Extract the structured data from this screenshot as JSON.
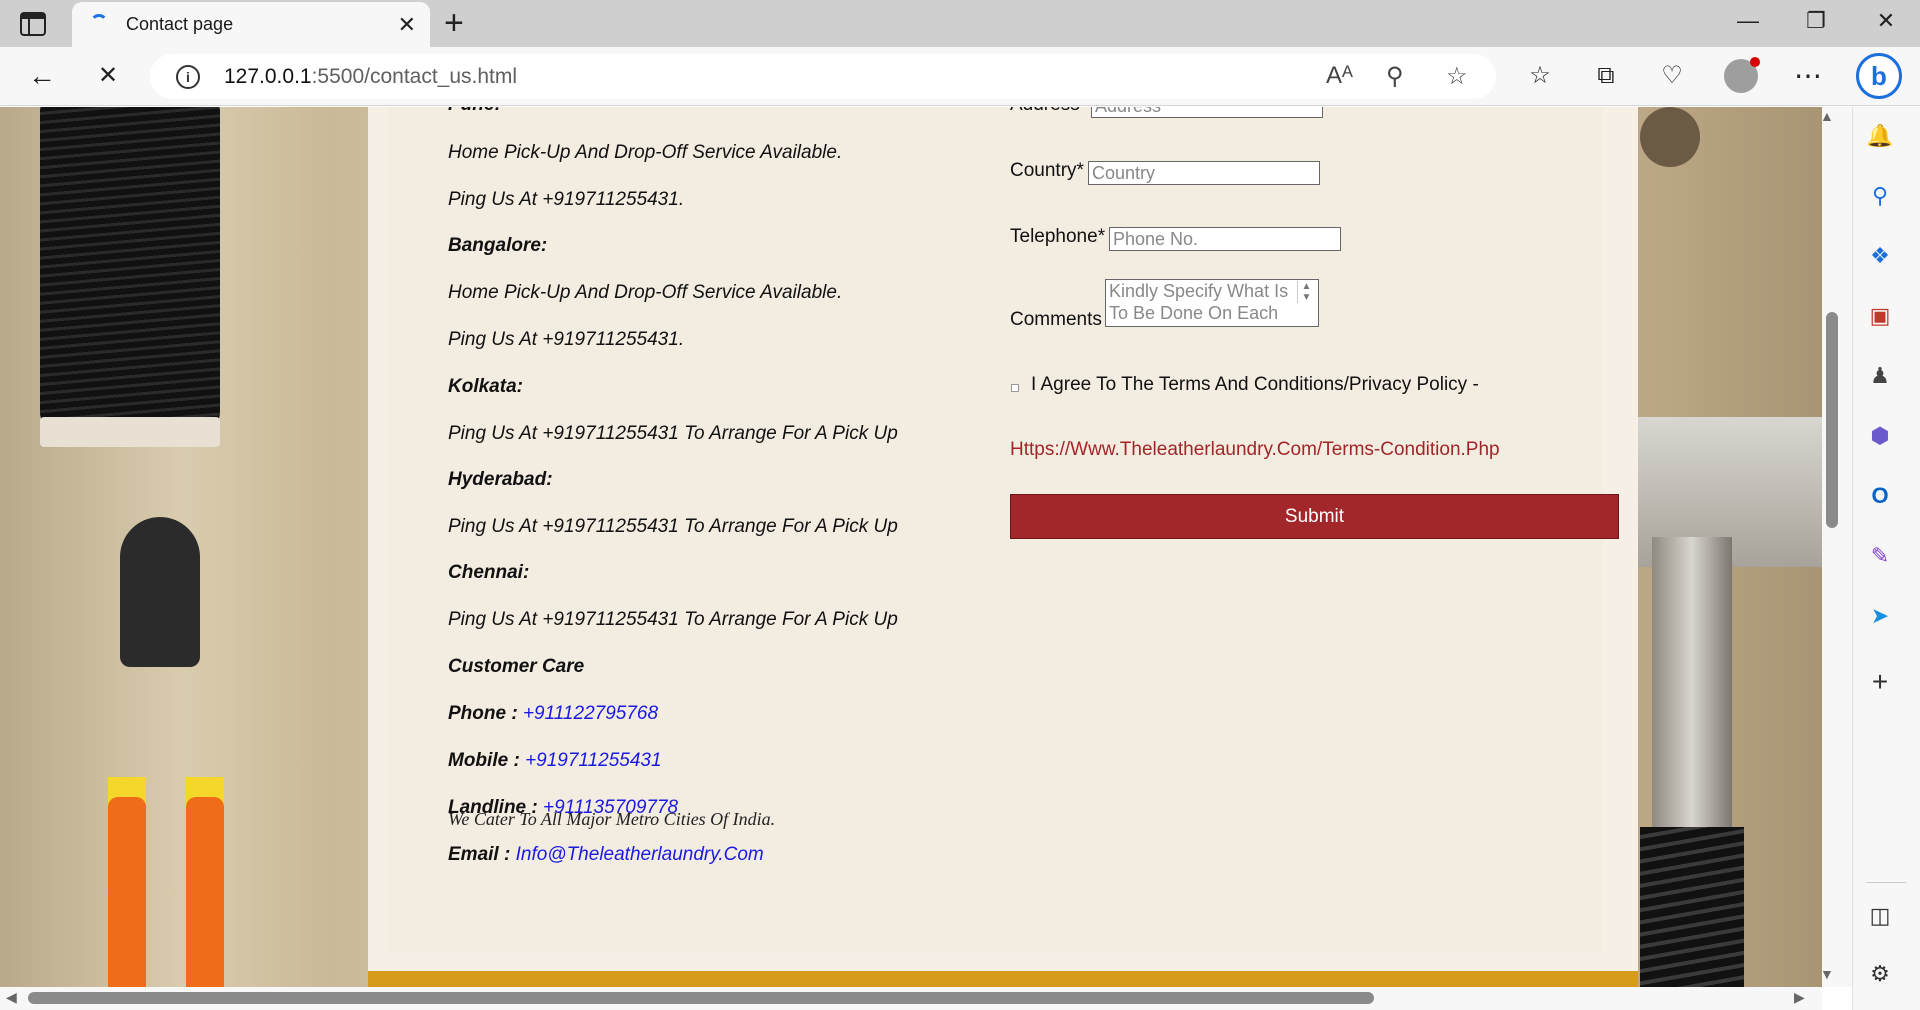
{
  "browser": {
    "tab_title": "Contact page",
    "new_tab": "+",
    "tab_close": "✕",
    "url_host": "127.0.0.1",
    "url_rest": ":5500/contact_us.html",
    "read_aloud_icon": "Ȃ",
    "window_controls": {
      "minimize": "—",
      "restore": "❐",
      "close": "✕"
    }
  },
  "contact": {
    "pune_label": "Pune:",
    "pune_line1": "Home Pick-Up And Drop-Off Service Available.",
    "pune_line2": "Ping Us At +919711255431.",
    "bangalore_label": "Bangalore:",
    "bangalore_line1": "Home Pick-Up And Drop-Off Service Available.",
    "bangalore_line2": "Ping Us At +919711255431.",
    "kolkata_label": "Kolkata:",
    "kolkata_line": "Ping Us At +919711255431 To Arrange For A Pick Up",
    "hyderabad_label": "Hyderabad:",
    "hyderabad_line": "Ping Us At +919711255431 To Arrange For A Pick Up",
    "chennai_label": "Chennai:",
    "chennai_line": "Ping Us At +919711255431 To Arrange For A Pick Up",
    "customer_care": "Customer Care",
    "phone_label": "Phone :",
    "phone_value": "+911122795768",
    "mobile_label": "Mobile :",
    "mobile_value": "+919711255431",
    "landline_label": "Landline :",
    "landline_value": "+911135709778",
    "email_label": "Email :",
    "email_value": "Info@Theleatherlaundry.Com",
    "tagline": "We Cater To All Major Metro Cities Of India."
  },
  "form": {
    "address_label": "Address*",
    "address_placeholder": "Address",
    "country_label": "Country*",
    "country_placeholder": "Country",
    "telephone_label": "Telephone*",
    "telephone_placeholder": "Phone No.",
    "comments_label": "Comments",
    "comments_placeholder": "Kindly Specify What Is To Be Done On Each",
    "agree_text": "I Agree To The Terms And Conditions/Privacy Policy -",
    "terms_link": "Https://Www.Theleatherlaundry.Com/Terms-Condition.Php",
    "submit_label": "Submit"
  },
  "colors": {
    "submit_bg": "#a1272a",
    "link_blue": "#1a1ae0",
    "terms_red": "#a22628",
    "gold_strip": "#d69a1d"
  }
}
